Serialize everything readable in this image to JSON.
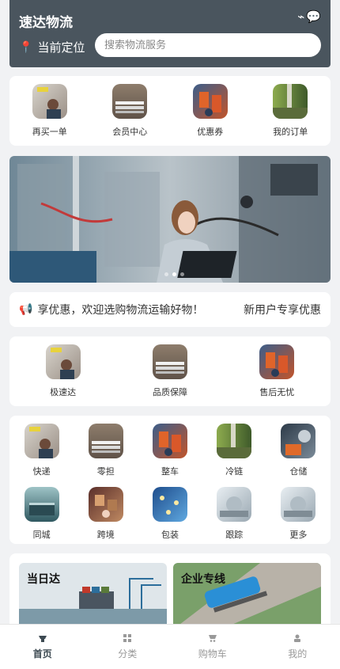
{
  "header": {
    "brand": "速达物流",
    "location_label": "当前定位",
    "search_placeholder": "搜索物流服务",
    "icons": [
      "signal-icon",
      "chat-icon"
    ]
  },
  "quick_actions": [
    {
      "label": "再买一单",
      "icon": "office-photo"
    },
    {
      "label": "会员中心",
      "icon": "keyboard-photo"
    },
    {
      "label": "优惠券",
      "icon": "robot-photo"
    },
    {
      "label": "我的订单",
      "icon": "warehouse-photo"
    }
  ],
  "banner": {
    "slides": 3,
    "active_slide": 1
  },
  "notice": {
    "marquee": "享优惠，欢迎选购物流运输好物！",
    "right": "新用户专享优惠"
  },
  "features": [
    {
      "label": "极速达",
      "icon": "office-photo"
    },
    {
      "label": "品质保障",
      "icon": "keyboard-photo"
    },
    {
      "label": "售后无忧",
      "icon": "robot-photo"
    }
  ],
  "services": [
    {
      "label": "快递",
      "icon": "office-photo"
    },
    {
      "label": "零担",
      "icon": "keyboard-photo"
    },
    {
      "label": "整车",
      "icon": "robot-photo"
    },
    {
      "label": "冷链",
      "icon": "warehouse-photo"
    },
    {
      "label": "仓储",
      "icon": "machine-photo"
    },
    {
      "label": "同城",
      "icon": "container-photo"
    },
    {
      "label": "跨境",
      "icon": "boxes-photo"
    },
    {
      "label": "包装",
      "icon": "lights-photo"
    },
    {
      "label": "跟踪",
      "icon": "factory-photo"
    },
    {
      "label": "更多",
      "icon": "factory-photo"
    }
  ],
  "promos": [
    {
      "label": "当日达",
      "image": "container-ship-photo"
    },
    {
      "label": "企业专线",
      "image": "truck-cargo-photo"
    }
  ],
  "tabbar": [
    {
      "label": "首页",
      "icon": "home-icon",
      "active": true
    },
    {
      "label": "分类",
      "icon": "grid-icon",
      "active": false
    },
    {
      "label": "购物车",
      "icon": "cart-icon",
      "active": false
    },
    {
      "label": "我的",
      "icon": "user-icon",
      "active": false
    }
  ],
  "colors": {
    "header": "#4a555e",
    "background": "#f1f2f4",
    "active_tab": "#3d4a52",
    "pin": "#e0413b"
  }
}
